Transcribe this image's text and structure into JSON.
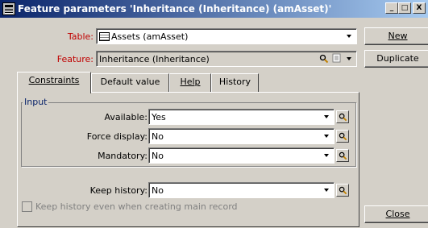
{
  "window": {
    "title": "Feature parameters 'Inheritance (Inheritance) (amAsset)'",
    "minimize": "_",
    "maximize": "□",
    "close": "X"
  },
  "fields": {
    "table": {
      "label": "Table:",
      "value": "Assets (amAsset)"
    },
    "feature": {
      "label": "Feature:",
      "value": "Inheritance (Inheritance)"
    }
  },
  "buttons": {
    "new": "New",
    "duplicate": "Duplicate",
    "close": "Close"
  },
  "tabs": [
    {
      "label": "Constraints",
      "active": true
    },
    {
      "label": "Default value",
      "active": false
    },
    {
      "label": "Help",
      "active": false
    },
    {
      "label": "History",
      "active": false
    }
  ],
  "input_group": {
    "title": "Input",
    "available": {
      "label": "Available:",
      "value": "Yes"
    },
    "force_display": {
      "label": "Force display:",
      "value": "No"
    },
    "mandatory": {
      "label": "Mandatory:",
      "value": "No"
    }
  },
  "keep_history": {
    "label": "Keep history:",
    "value": "No"
  },
  "keep_history_creating": {
    "label": "Keep history even when creating main record",
    "checked": false,
    "enabled": false
  }
}
